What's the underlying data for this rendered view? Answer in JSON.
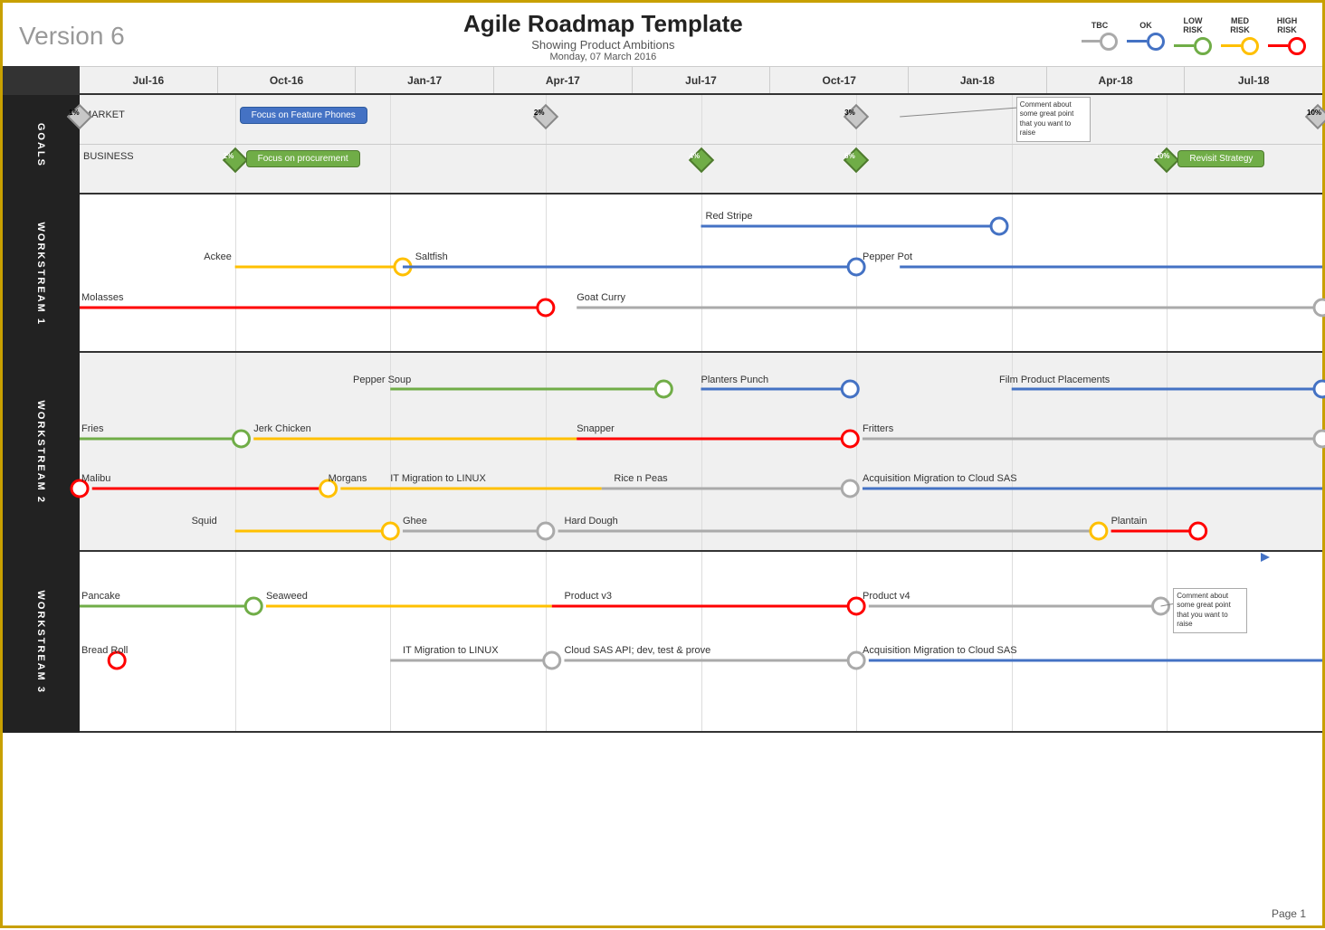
{
  "header": {
    "version": "Version 6",
    "title": "Agile Roadmap Template",
    "subtitle": "Showing Product Ambitions",
    "date": "Monday, 07 March 2016"
  },
  "legend": {
    "items": [
      {
        "label": "TBC",
        "color": "#aaaaaa"
      },
      {
        "label": "OK",
        "color": "#4472c4"
      },
      {
        "label": "LOW\nRISK",
        "color": "#70ad47"
      },
      {
        "label": "MED\nRISK",
        "color": "#ffc000"
      },
      {
        "label": "HIGH\nRISK",
        "color": "#ff0000"
      }
    ]
  },
  "timeline": {
    "labels": [
      "Jul-16",
      "Oct-16",
      "Jan-17",
      "Apr-17",
      "Jul-17",
      "Oct-17",
      "Jan-18",
      "Apr-18",
      "Jul-18"
    ]
  },
  "sections": {
    "goals": {
      "label": "GOALS",
      "rows": [
        {
          "name": "MARKET"
        },
        {
          "name": "BUSINESS"
        }
      ]
    },
    "workstream1": {
      "label": "WORKSTREAM 1"
    },
    "workstream2": {
      "label": "WORKSTREAM 2"
    },
    "workstream3": {
      "label": "WORKSTREAM 3"
    }
  },
  "page": "Page 1"
}
